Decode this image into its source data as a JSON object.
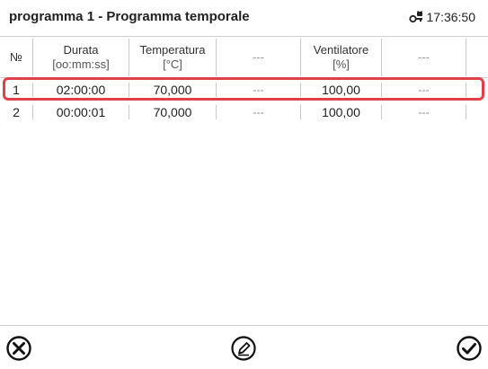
{
  "header": {
    "title": "programma 1 - Programma temporale",
    "time": "17:36:50",
    "lock_icon": "lock-key-icon"
  },
  "table": {
    "columns": [
      {
        "line1": "№",
        "line2": ""
      },
      {
        "line1": "Durata",
        "line2": "[oo:mm:ss]"
      },
      {
        "line1": "Temperatura",
        "line2": "[°C]"
      },
      {
        "line1": "---",
        "line2": ""
      },
      {
        "line1": "Ventilatore",
        "line2": "[%]"
      },
      {
        "line1": "---",
        "line2": ""
      }
    ],
    "rows": [
      {
        "no": "1",
        "durata": "02:00:00",
        "temperatura": "70,000",
        "col4": "---",
        "ventilatore": "100,00",
        "col6": "---"
      },
      {
        "no": "2",
        "durata": "00:00:01",
        "temperatura": "70,000",
        "col4": "---",
        "ventilatore": "100,00",
        "col6": "---"
      }
    ],
    "selected_row": 1
  },
  "footer": {
    "cancel_icon": "close-circle-icon",
    "edit_icon": "edit-pencil-icon",
    "confirm_icon": "check-circle-icon"
  },
  "colors": {
    "highlight": "#e0404a",
    "divider": "#cfcfcf"
  }
}
